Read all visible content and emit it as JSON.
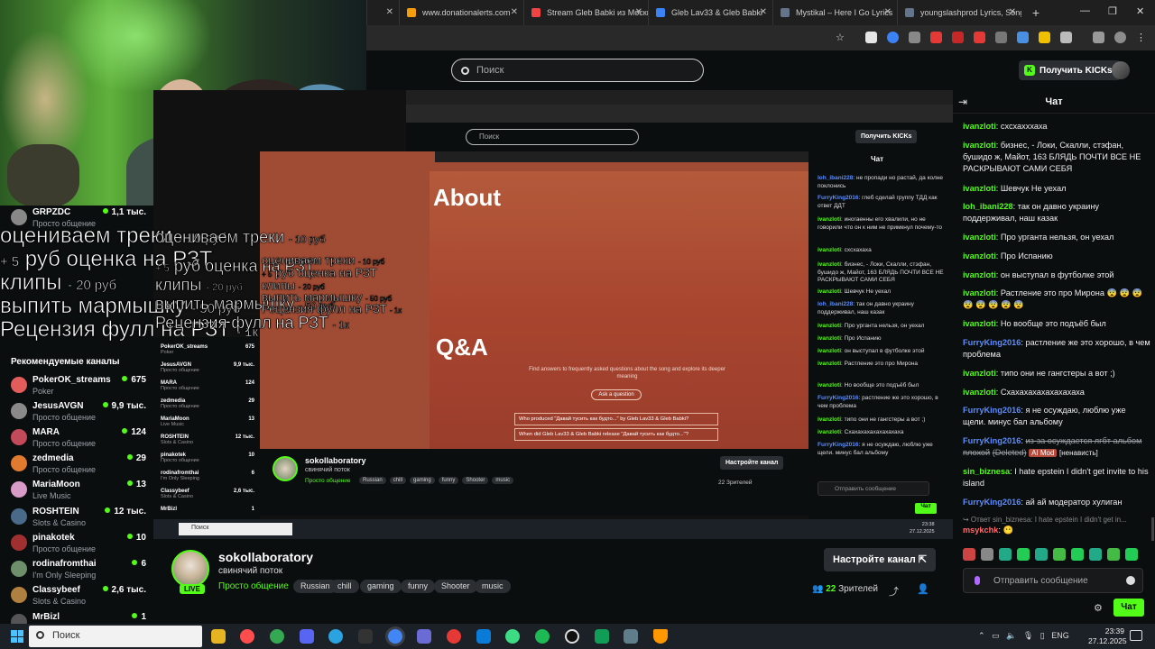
{
  "browser": {
    "tabs": [
      {
        "title": "www.donationalerts.com",
        "color": "#f59e0b"
      },
      {
        "title": "Stream Gleb Babki из Москвы",
        "color": "#ef4444"
      },
      {
        "title": "Gleb Lav33 & Gleb Babki",
        "color": "#3b82f6"
      },
      {
        "title": "Mystikal – Here I Go Lyrics",
        "color": "#64748b"
      },
      {
        "title": "youngslashprod Lyrics, Songs",
        "color": "#64748b"
      }
    ],
    "new_tab": "+",
    "window_controls": {
      "minimize": "—",
      "maximize": "❐",
      "close": "✕"
    }
  },
  "kick_header": {
    "search_placeholder": "Поиск",
    "get_kicks": "Получить KICKs",
    "kicks_icon": "K"
  },
  "overlay": {
    "line1_text": "оцениваем треки",
    "line1_price": "- 10 руб",
    "line2_prefix": "+ 5",
    "line2_text": "руб оценка на РЗТ",
    "line3_text": "клипы",
    "line3_price": "- 20 руб",
    "line4_text": "выпить мармышку",
    "line4_price": "- 50 руб",
    "line5_text": "Рецензия фулл на РЗТ",
    "line5_price": "- 1к"
  },
  "sidebar": {
    "top_channels": [
      {
        "name": "GRPZDC",
        "category": "Просто общение",
        "viewers": "1,1 тыс."
      }
    ],
    "recommended_title": "Рекомендуемые каналы",
    "recommended": [
      {
        "name": "PokerOK_streams",
        "category": "Poker",
        "viewers": "675",
        "color": "#e25c5c"
      },
      {
        "name": "JesusAVGN",
        "category": "Просто общение",
        "viewers": "9,9 тыс.",
        "color": "#8a8a8a"
      },
      {
        "name": "MARA",
        "category": "Просто общение",
        "viewers": "124",
        "color": "#c24a5a"
      },
      {
        "name": "zedmedia",
        "category": "Просто общение",
        "viewers": "29",
        "color": "#e07a2e"
      },
      {
        "name": "MariaMoon",
        "category": "Live Music",
        "viewers": "13",
        "color": "#d89ac6"
      },
      {
        "name": "ROSHTEIN",
        "category": "Slots & Casino",
        "viewers": "12 тыс.",
        "color": "#4a6a8a"
      },
      {
        "name": "pinakotek",
        "category": "Просто общение",
        "viewers": "10",
        "color": "#a03030"
      },
      {
        "name": "rodinafromthai",
        "category": "I'm Only Sleeping",
        "viewers": "6",
        "color": "#6d8f6a"
      },
      {
        "name": "Classybeef",
        "category": "Slots & Casino",
        "viewers": "2,6 тыс.",
        "color": "#b08040"
      },
      {
        "name": "MrBizl",
        "category": "",
        "viewers": "1",
        "color": "#555555"
      }
    ]
  },
  "player_capture": {
    "mini_search": "Поиск",
    "mini_kicks": "Получить KICKs",
    "mini_chat_title": "Чат",
    "about_heading": "About",
    "qa_heading": "Q&A",
    "qa_sub": "Find answers to frequently asked questions about the song and explore its deeper meaning",
    "ask_button": "Ask a question",
    "faq": [
      "Who produced \"Давай тусить как будто...\" by Gleb Lav33 & Gleb Babki?",
      "When did Gleb Lav33 & Gleb Babki release \"Давай тусить как будто...\"?"
    ],
    "mini_chat": [
      {
        "user": "loh_ibani228",
        "text": "не пропади но растай, да колне поклонись"
      },
      {
        "user": "FurryKing2016",
        "text": "глеб сделай группу ТДД как ответ ДДТ"
      },
      {
        "user": "ivanzloti",
        "text": "иногаенны его хвалили, но не говорили что он к ним не примкнул почему-то"
      },
      {
        "user": "ivanzloti",
        "text": "схсхахаха"
      },
      {
        "user": "ivanzloti",
        "text": "бизнес, - Локи, Скалли, стэфан, бушидо ж, Майот, 163 БЛЯДЬ ПОЧТИ ВСЕ НЕ РАСКРЫВАЮТ САМИ СЕБЯ"
      },
      {
        "user": "ivanzloti",
        "text": "Шевчук Не уехал"
      },
      {
        "user": "loh_ibani228",
        "text": "так он давно украину поддерживал, наш казак"
      },
      {
        "user": "ivanzloti",
        "text": "Про урганта нельзя, он уехал"
      },
      {
        "user": "ivanzloti",
        "text": "Про Испанию"
      },
      {
        "user": "ivanzloti",
        "text": "он выступал в футболке этой"
      },
      {
        "user": "ivanzloti",
        "text": "Растление это про Мирона"
      },
      {
        "user": "ivanzloti",
        "text": "Но вообще это подъёб был"
      },
      {
        "user": "FurryKing2016",
        "text": "растление же это хорошо, в чем проблема"
      },
      {
        "user": "ivanzloti",
        "text": "типо они не гангстеры а вот ;)"
      },
      {
        "user": "ivanzloti",
        "text": "Схахахахахахахахаха"
      },
      {
        "user": "FurryKing2016",
        "text": "я не осуждаю, люблю уже щели. минус бал альбому"
      }
    ],
    "mini_chat_input": "Отправить сообщение",
    "mini_send": "Чат",
    "mini_stream_name": "sokollaboratory",
    "mini_stream_title": "свинячий поток",
    "mini_category": "Просто общение",
    "mini_tags": [
      "Russian",
      "chill",
      "gaming",
      "funny",
      "Shooter",
      "music"
    ],
    "mini_setup": "Настройте канал",
    "mini_viewers": "22 Зрителей",
    "mini_taskbar_search": "Поиск",
    "mini_clock_time": "23:38",
    "mini_clock_date": "27.12.2025",
    "mini_sidebar": [
      {
        "name": "PokerOK_streams",
        "sub": "Poker",
        "v": "675"
      },
      {
        "name": "JesusAVGN",
        "sub": "Просто общение",
        "v": "9,9 тыс."
      },
      {
        "name": "MARA",
        "sub": "Просто общение",
        "v": "124"
      },
      {
        "name": "zedmedia",
        "sub": "Просто общение",
        "v": "29"
      },
      {
        "name": "MariaMoon",
        "sub": "Live Music",
        "v": "13"
      },
      {
        "name": "ROSHTEIN",
        "sub": "Slots & Casino",
        "v": "12 тыс."
      },
      {
        "name": "pinakotek",
        "sub": "Просто общение",
        "v": "10"
      },
      {
        "name": "rodinafromthai",
        "sub": "I'm Only Sleeping",
        "v": "6"
      },
      {
        "name": "Classybeef",
        "sub": "Slots & Casino",
        "v": "2,6 тыс."
      },
      {
        "name": "MrBizl",
        "sub": "",
        "v": "1"
      }
    ]
  },
  "stream": {
    "channel": "sokollaboratory",
    "title": "свинячий поток",
    "live": "LIVE",
    "category": "Просто общение",
    "tags": [
      "Russian",
      "chill",
      "gaming",
      "funny",
      "Shooter",
      "music"
    ],
    "setup_button": "Настройте канал",
    "viewers_count": "22",
    "viewers_label": "Зрителей"
  },
  "chat": {
    "title": "Чат",
    "messages": [
      {
        "user": "ivanzloti",
        "color": "green",
        "text": "схсхахххаха"
      },
      {
        "user": "ivanzloti",
        "color": "green",
        "text": "бизнес, - Локи, Скалли, стэфан, бушидо ж, Майот, 163 БЛЯДЬ ПОЧТИ ВСЕ НЕ РАСКРЫВАЮТ САМИ СЕБЯ"
      },
      {
        "user": "ivanzloti",
        "color": "green",
        "text": "Шевчук Не уехал"
      },
      {
        "user": "loh_ibani228",
        "color": "green",
        "text": "так он давно украину поддерживал, наш казак"
      },
      {
        "user": "ivanzloti",
        "color": "green",
        "text": "Про урганта нельзя, он уехал"
      },
      {
        "user": "ivanzloti",
        "color": "green",
        "text": "Про Испанию"
      },
      {
        "user": "ivanzloti",
        "color": "green",
        "text": "он выступал в футболке этой"
      },
      {
        "user": "ivanzloti",
        "color": "green",
        "text": "Растление это про Мирона 😨 😨 😨 😨 😨 😨 😨 😨"
      },
      {
        "user": "ivanzloti",
        "color": "green",
        "text": "Но вообще это подъёб был"
      },
      {
        "user": "FurryKing2016",
        "color": "blue",
        "text": "растление же это хорошо, в чем проблема"
      },
      {
        "user": "ivanzloti",
        "color": "green",
        "text": "типо они не гангстеры а вот ;)"
      },
      {
        "user": "ivanzloti",
        "color": "green",
        "text": "Схахахахахахахахаха"
      },
      {
        "user": "FurryKing2016",
        "color": "blue",
        "text": "я не осуждаю, люблю уже щели. минус бал альбому"
      }
    ],
    "deleted_msg": {
      "user": "FurryKing2016",
      "text": "из-за осуждается лгбт альбом плохой",
      "deleted": "(Deleted)",
      "mod_chip": "AI Mod",
      "reason": "[ненависть]"
    },
    "msg_after": [
      {
        "user": "sin_biznesa",
        "color": "green",
        "text": "I hate epstein I didn't get invite to his island"
      },
      {
        "user": "FurryKing2016",
        "color": "blue",
        "text": "ай ай модератор хулиган"
      }
    ],
    "reply_preview": "↪ Ответ sin_biznesa: I hate epstein I didn't get in...",
    "last_user": "msykchk",
    "input_placeholder": "Отправить сообщение",
    "send_button": "Чат",
    "emote_colors": [
      "#c44",
      "#888",
      "#2a8",
      "#2c5",
      "#2a8",
      "#4b4",
      "#2c5",
      "#2a8",
      "#4b4",
      "#2c5"
    ]
  },
  "taskbar": {
    "search_placeholder": "Поиск",
    "tray_lang": "ENG",
    "time": "23:39",
    "date": "27.12.2025",
    "app_colors": [
      "#e6b422",
      "#ff4d4d",
      "#34a853",
      "#5865f2",
      "#2aa3e0",
      "#333333",
      "#4285f4",
      "#6b6bd6",
      "#e53935",
      "#0a7bd6",
      "#3ddc84",
      "#1db954",
      "#111111",
      "#0f9d58",
      "#607d8b",
      "#ff9800"
    ]
  }
}
